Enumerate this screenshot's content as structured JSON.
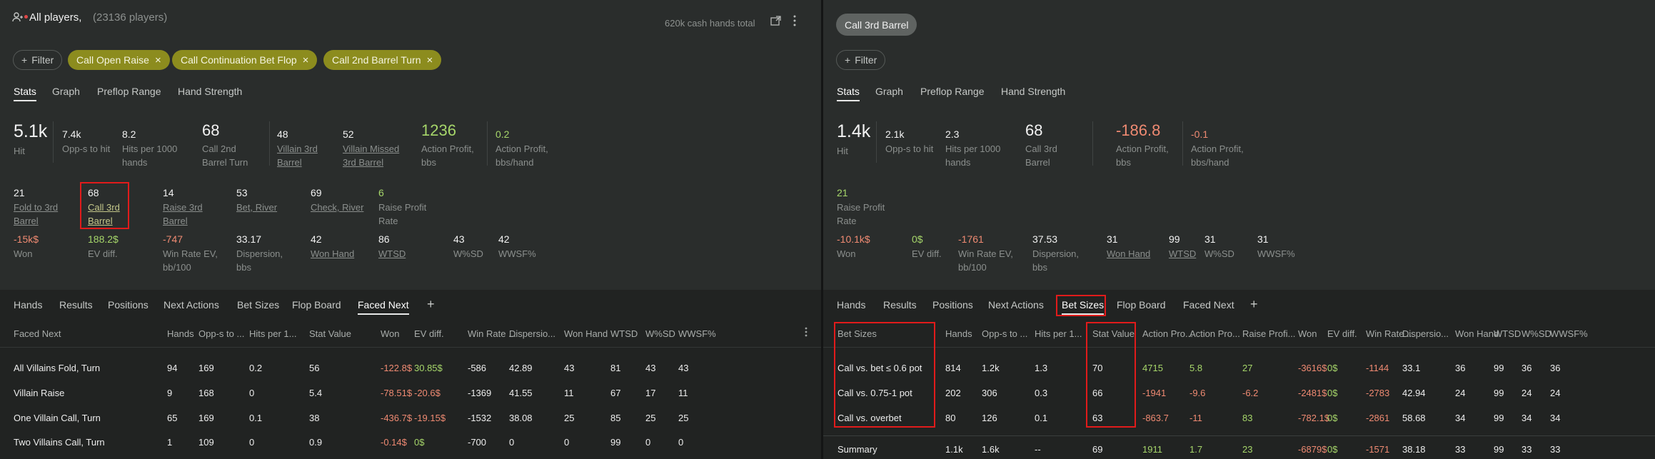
{
  "left": {
    "header": {
      "title": "All players,",
      "count": "(23136 players)",
      "hands_total": "620k cash hands total"
    },
    "filter_label": "Filter",
    "chips": [
      "Call Open Raise",
      "Call Continuation Bet Flop",
      "Call 2nd Barrel Turn"
    ],
    "tabs": [
      "Stats",
      "Graph",
      "Preflop Range",
      "Hand Strength"
    ],
    "stats_row1": [
      {
        "v": "5.1k",
        "l1": "Hit",
        "l2": ""
      },
      {
        "v": "7.4k",
        "l1": "Opp-s to hit",
        "l2": ""
      },
      {
        "v": "8.2",
        "l1": "Hits per 1000",
        "l2": "hands"
      },
      {
        "v": "68",
        "l1": "Call 2nd",
        "l2": "Barrel Turn"
      },
      {
        "v": "48",
        "l1": "Villain 3rd",
        "l2": "Barrel"
      },
      {
        "v": "52",
        "l1": "Villain Missed",
        "l2": "3rd Barrel"
      },
      {
        "v": "1236",
        "l1": "Action Profit,",
        "l2": "bbs"
      },
      {
        "v": "0.2",
        "l1": "Action Profit,",
        "l2": "bbs/hand"
      }
    ],
    "stats_row2": [
      {
        "v": "21",
        "l1": "Fold to 3rd",
        "l2": "Barrel"
      },
      {
        "v": "68",
        "l1": "Call 3rd",
        "l2": "Barrel"
      },
      {
        "v": "14",
        "l1": "Raise 3rd",
        "l2": "Barrel"
      },
      {
        "v": "53",
        "l1": "Bet, River",
        "l2": ""
      },
      {
        "v": "69",
        "l1": "Check, River",
        "l2": ""
      },
      {
        "v": "6",
        "l1": "Raise Profit",
        "l2": "Rate"
      }
    ],
    "stats_row3": [
      {
        "v": "-15k$",
        "l1": "Won",
        "l2": ""
      },
      {
        "v": "188.2$",
        "l1": "EV diff.",
        "l2": ""
      },
      {
        "v": "-747",
        "l1": "Win Rate EV,",
        "l2": "bb/100"
      },
      {
        "v": "33.17",
        "l1": "Dispersion,",
        "l2": "bbs"
      },
      {
        "v": "42",
        "l1": "Won Hand",
        "l2": ""
      },
      {
        "v": "86",
        "l1": "WTSD",
        "l2": ""
      },
      {
        "v": "43",
        "l1": "W%SD",
        "l2": ""
      },
      {
        "v": "42",
        "l1": "WWSF%",
        "l2": ""
      }
    ],
    "bottom_tabs": [
      "Hands",
      "Results",
      "Positions",
      "Next Actions",
      "Bet Sizes",
      "Flop Board",
      "Faced Next",
      "+"
    ],
    "table": {
      "headers": [
        "Faced Next",
        "Hands",
        "Opp-s to ...",
        "Hits per 1...",
        "Stat Value",
        "Won",
        "EV diff.",
        "Win Rate ...",
        "Dispersio...",
        "Won Hand",
        "WTSD",
        "W%SD",
        "WWSF%"
      ],
      "rows": [
        [
          "All Villains Fold, Turn",
          "94",
          "169",
          "0.2",
          "56",
          "-122.8$",
          "30.85$",
          "-586",
          "42.89",
          "43",
          "81",
          "43",
          "43"
        ],
        [
          "Villain Raise",
          "9",
          "168",
          "0",
          "5.4",
          "-78.51$",
          "-20.6$",
          "-1369",
          "41.55",
          "11",
          "67",
          "17",
          "11"
        ],
        [
          "One Villain Call, Turn",
          "65",
          "169",
          "0.1",
          "38",
          "-436.7$",
          "-19.15$",
          "-1532",
          "38.08",
          "25",
          "85",
          "25",
          "25"
        ],
        [
          "Two Villains Call, Turn",
          "1",
          "109",
          "0",
          "0.9",
          "-0.14$",
          "0$",
          "-700",
          "0",
          "0",
          "99",
          "0",
          "0"
        ]
      ]
    }
  },
  "right": {
    "chip": "Call 3rd Barrel",
    "filter_label": "Filter",
    "tabs": [
      "Stats",
      "Graph",
      "Preflop Range",
      "Hand Strength"
    ],
    "stats_row1": [
      {
        "v": "1.4k",
        "l1": "Hit",
        "l2": ""
      },
      {
        "v": "2.1k",
        "l1": "Opp-s to hit",
        "l2": ""
      },
      {
        "v": "2.3",
        "l1": "Hits per 1000",
        "l2": "hands"
      },
      {
        "v": "68",
        "l1": "Call 3rd",
        "l2": "Barrel"
      },
      {
        "v": "-186.8",
        "l1": "Action Profit,",
        "l2": "bbs"
      },
      {
        "v": "-0.1",
        "l1": "Action Profit,",
        "l2": "bbs/hand"
      }
    ],
    "stats_row2": [
      {
        "v": "21",
        "l1": "Raise Profit",
        "l2": "Rate"
      }
    ],
    "stats_row3": [
      {
        "v": "-10.1k$",
        "l1": "Won",
        "l2": ""
      },
      {
        "v": "0$",
        "l1": "EV diff.",
        "l2": ""
      },
      {
        "v": "-1761",
        "l1": "Win Rate EV,",
        "l2": "bb/100"
      },
      {
        "v": "37.53",
        "l1": "Dispersion,",
        "l2": "bbs"
      },
      {
        "v": "31",
        "l1": "Won Hand",
        "l2": ""
      },
      {
        "v": "99",
        "l1": "WTSD",
        "l2": ""
      },
      {
        "v": "31",
        "l1": "W%SD",
        "l2": ""
      },
      {
        "v": "31",
        "l1": "WWSF%",
        "l2": ""
      }
    ],
    "bottom_tabs": [
      "Hands",
      "Results",
      "Positions",
      "Next Actions",
      "Bet Sizes",
      "Flop Board",
      "Faced Next",
      "+"
    ],
    "table": {
      "headers": [
        "Bet Sizes",
        "Hands",
        "Opp-s to ...",
        "Hits per 1...",
        "Stat Value",
        "Action Pro...",
        "Action Pro...",
        "Raise Profi...",
        "Won",
        "EV diff.",
        "Win Rate ...",
        "Dispersio...",
        "Won Hand",
        "WTSD",
        "W%SD",
        "WWSF%"
      ],
      "rows": [
        [
          "Call vs. bet ≤ 0.6 pot",
          "814",
          "1.2k",
          "1.3",
          "70",
          "4715",
          "5.8",
          "27",
          "-3616$",
          "0$",
          "-1144",
          "33.1",
          "36",
          "99",
          "36",
          "36"
        ],
        [
          "Call vs. 0.75-1 pot",
          "202",
          "306",
          "0.3",
          "66",
          "-1941",
          "-9.6",
          "-6.2",
          "-2481$",
          "0$",
          "-2783",
          "42.94",
          "24",
          "99",
          "24",
          "24"
        ],
        [
          "Call vs. overbet",
          "80",
          "126",
          "0.1",
          "63",
          "-863.7",
          "-11",
          "83",
          "-782.1$",
          "0$",
          "-2861",
          "58.68",
          "34",
          "99",
          "34",
          "34"
        ]
      ],
      "summary": [
        "Summary",
        "1.1k",
        "1.6k",
        "--",
        "69",
        "1911",
        "1.7",
        "23",
        "-6879$",
        "0$",
        "-1571",
        "38.18",
        "33",
        "99",
        "33",
        "33"
      ]
    }
  },
  "colors": {
    "chip_olive": "#8c8c1e",
    "profit_green": "#a6d66a",
    "loss_red": "#ef8a72",
    "highlight_box": "#e11b1b"
  }
}
